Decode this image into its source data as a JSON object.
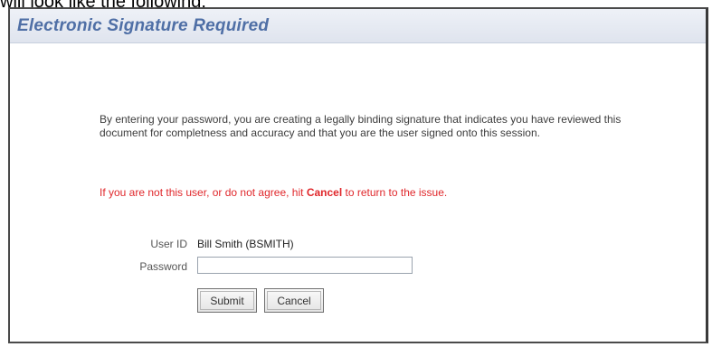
{
  "caption": "will look like the following:",
  "dialog": {
    "title": "Electronic Signature Required",
    "message": "By entering your password, you are creating a legally binding signature that indicates you have reviewed this document for completness and accuracy and that you are the user signed onto this session.",
    "warning": {
      "before": "If you are not this user, or do not agree, hit ",
      "emphasis": "Cancel",
      "after": " to return to the issue."
    },
    "user_id_label": "User ID",
    "user_id_value": "Bill Smith (BSMITH)",
    "password_label": "Password",
    "password_value": "",
    "submit_label": "Submit",
    "cancel_label": "Cancel"
  }
}
